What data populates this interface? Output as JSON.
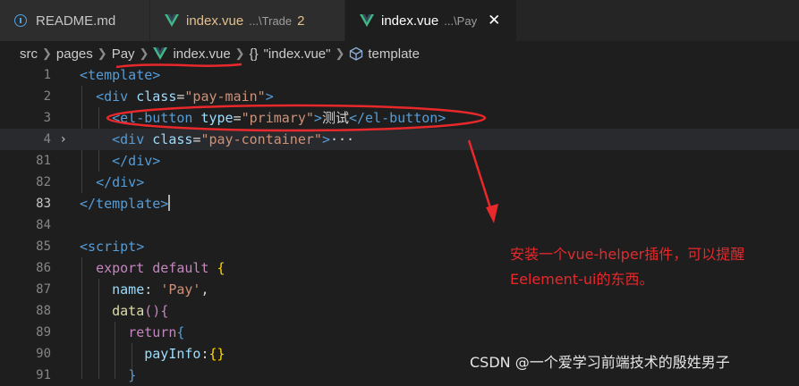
{
  "tabs": [
    {
      "name": "README.md",
      "desc": "",
      "count": "",
      "active": false,
      "icon": "info-icon"
    },
    {
      "name": "index.vue",
      "desc": "...\\Trade",
      "count": "2",
      "active": false,
      "icon": "vue-icon"
    },
    {
      "name": "index.vue",
      "desc": "...\\Pay",
      "count": "",
      "active": true,
      "icon": "vue-icon",
      "close": "✕"
    }
  ],
  "breadcrumb": {
    "segments": [
      "src",
      "pages",
      "Pay",
      "index.vue",
      "\"index.vue\"",
      "template"
    ],
    "braces": "{}"
  },
  "code_lines": [
    {
      "num": "1",
      "segments": [
        {
          "t": "<template>",
          "c": "tag"
        }
      ]
    },
    {
      "num": "2",
      "segments": [
        {
          "t": "  "
        },
        {
          "t": "<div",
          "c": "tag"
        },
        {
          "t": " class",
          "c": "attr"
        },
        {
          "t": "=",
          "c": "txt"
        },
        {
          "t": "\"pay-main\"",
          "c": "str"
        },
        {
          "t": ">",
          "c": "tag"
        }
      ]
    },
    {
      "num": "3",
      "segments": [
        {
          "t": "    "
        },
        {
          "t": "<el-button",
          "c": "tag"
        },
        {
          "t": " type",
          "c": "attr"
        },
        {
          "t": "=",
          "c": "txt"
        },
        {
          "t": "\"primary\"",
          "c": "str"
        },
        {
          "t": ">",
          "c": "tag"
        },
        {
          "t": "测试",
          "c": "txt"
        },
        {
          "t": "</el-button>",
          "c": "tag"
        }
      ]
    },
    {
      "num": "4",
      "fold": "›",
      "highlight": true,
      "segments": [
        {
          "t": "    "
        },
        {
          "t": "<div",
          "c": "tag"
        },
        {
          "t": " class",
          "c": "attr"
        },
        {
          "t": "=",
          "c": "txt"
        },
        {
          "t": "\"pay-container\"",
          "c": "str"
        },
        {
          "t": ">",
          "c": "tag"
        },
        {
          "t": "···",
          "c": "txt"
        }
      ]
    },
    {
      "num": "81",
      "segments": [
        {
          "t": "    "
        },
        {
          "t": "</div>",
          "c": "tag"
        }
      ]
    },
    {
      "num": "82",
      "segments": [
        {
          "t": "  "
        },
        {
          "t": "</div>",
          "c": "tag"
        }
      ]
    },
    {
      "num": "83",
      "current": true,
      "cursor": true,
      "segments": [
        {
          "t": "</template>",
          "c": "tag"
        }
      ]
    },
    {
      "num": "84",
      "segments": []
    },
    {
      "num": "85",
      "segments": [
        {
          "t": "<script>",
          "c": "tag"
        }
      ]
    },
    {
      "num": "86",
      "segments": [
        {
          "t": "  "
        },
        {
          "t": "export",
          "c": "kw"
        },
        {
          "t": " "
        },
        {
          "t": "default",
          "c": "kw"
        },
        {
          "t": " "
        },
        {
          "t": "{",
          "c": "brace"
        }
      ]
    },
    {
      "num": "87",
      "segments": [
        {
          "t": "    "
        },
        {
          "t": "name",
          "c": "prop"
        },
        {
          "t": ": ",
          "c": "txt"
        },
        {
          "t": "'Pay'",
          "c": "str"
        },
        {
          "t": ",",
          "c": "txt"
        }
      ]
    },
    {
      "num": "88",
      "segments": [
        {
          "t": "    "
        },
        {
          "t": "data",
          "c": "fn"
        },
        {
          "t": "()",
          "c": "kw"
        },
        {
          "t": "{",
          "c": "kw"
        }
      ]
    },
    {
      "num": "89",
      "segments": [
        {
          "t": "      "
        },
        {
          "t": "return",
          "c": "kw"
        },
        {
          "t": "{",
          "c": "kw2"
        }
      ]
    },
    {
      "num": "90",
      "segments": [
        {
          "t": "        "
        },
        {
          "t": "payInfo",
          "c": "prop"
        },
        {
          "t": ":",
          "c": "txt"
        },
        {
          "t": "{}",
          "c": "brace"
        }
      ]
    },
    {
      "num": "91",
      "segments": [
        {
          "t": "      "
        },
        {
          "t": "}",
          "c": "kw2"
        }
      ]
    }
  ],
  "annotation": {
    "note": "安装一个vue-helper插件，可以提醒Eelement-ui的东西。",
    "color": "#e8282b"
  },
  "watermark": "CSDN @一个爱学习前端技术的殷姓男子",
  "colors": {
    "background": "#1e1e1e",
    "tag": "#569cd6",
    "attribute": "#9cdcfe",
    "string": "#ce9178",
    "keyword": "#c586c0",
    "vue_icon": "#41b883"
  }
}
